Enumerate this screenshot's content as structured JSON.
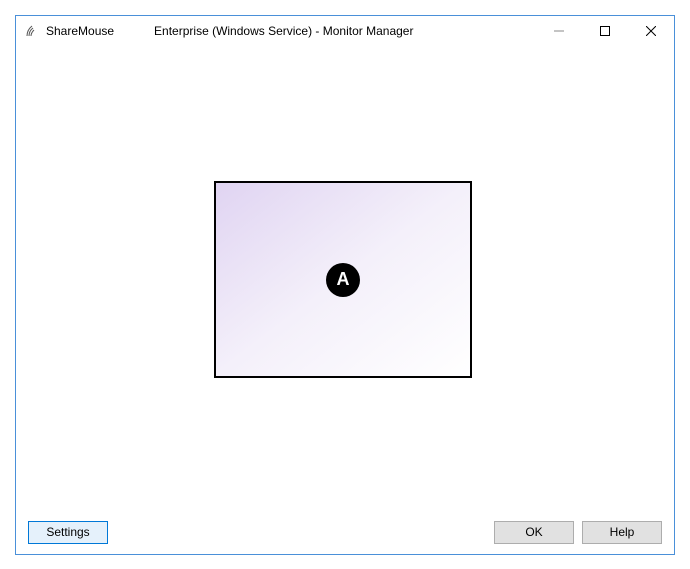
{
  "window": {
    "app_name": "ShareMouse",
    "title": "Enterprise (Windows Service) - Monitor Manager"
  },
  "monitor": {
    "label": "A"
  },
  "buttons": {
    "settings": "Settings",
    "ok": "OK",
    "help": "Help"
  }
}
